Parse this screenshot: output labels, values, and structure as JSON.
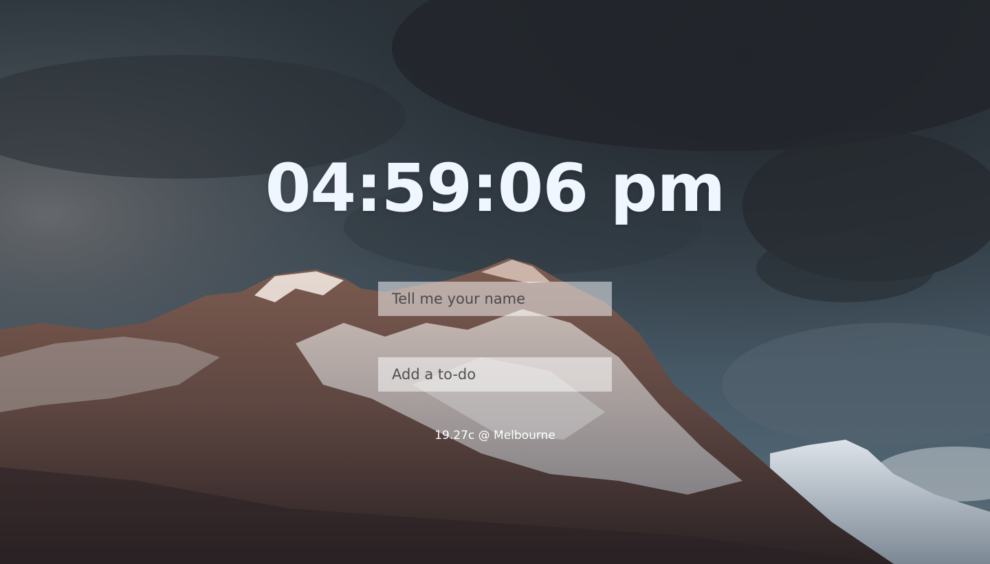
{
  "clock": {
    "time": "04:59:06 pm"
  },
  "name_input": {
    "value": "",
    "placeholder": "Tell me your name"
  },
  "todo_input": {
    "value": "",
    "placeholder": "Add a to-do"
  },
  "weather": {
    "text": "19.27c @ Melbourne"
  },
  "background": {
    "subject": "snow-capped mountain under a cloudy dusk sky",
    "sky_color": "#3a4a56",
    "cloud_color": "#23272c",
    "rock_color": "#6e5148",
    "snow_color": "#e3e5e8"
  },
  "colors": {
    "clock_text": "#f0f6ff",
    "input_bg": "rgba(255,255,255,0.5)"
  }
}
